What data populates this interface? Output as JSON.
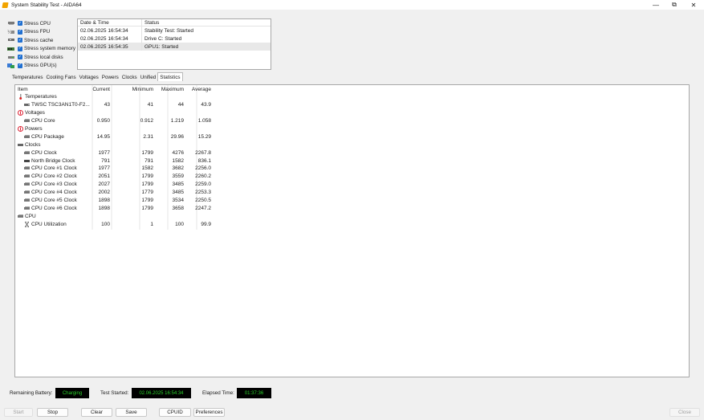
{
  "window": {
    "title": "System Stability Test - AIDA64",
    "minimize_glyph": "—",
    "maximize_glyph": "⧉",
    "close_glyph": "✕"
  },
  "stress_options": [
    {
      "label": "Stress CPU",
      "icon": "cpu-icon",
      "checked": true
    },
    {
      "label": "Stress FPU",
      "icon": "fpu-icon",
      "checked": true
    },
    {
      "label": "Stress cache",
      "icon": "cache-icon",
      "checked": true
    },
    {
      "label": "Stress system memory",
      "icon": "memory-icon",
      "checked": true
    },
    {
      "label": "Stress local disks",
      "icon": "disk-icon",
      "checked": true
    },
    {
      "label": "Stress GPU(s)",
      "icon": "gpu-icon",
      "checked": true
    }
  ],
  "log": {
    "headers": [
      "Date & Time",
      "Status"
    ],
    "rows": [
      {
        "time": "02.06.2025 16:54:34",
        "status": "Stability Test: Started"
      },
      {
        "time": "02.06.2025 16:54:34",
        "status": "Drive C: Started"
      },
      {
        "time": "02.06.2025 16:54:35",
        "status": "GPU1: Started"
      }
    ]
  },
  "tabs": [
    "Temperatures",
    "Cooling Fans",
    "Voltages",
    "Powers",
    "Clocks",
    "Unified",
    "Statistics"
  ],
  "active_tab": "Statistics",
  "stats": {
    "headers": {
      "item": "Item",
      "current": "Current",
      "minimum": "Minimum",
      "maximum": "Maximum",
      "average": "Average"
    },
    "rows": [
      {
        "level": 1,
        "icon": "thermometer-icon",
        "label": "Temperatures",
        "cur": "",
        "min": "",
        "max": "",
        "avg": ""
      },
      {
        "level": 2,
        "icon": "drive-icon",
        "label": "TWSC TSC3AN1T0-F2...",
        "cur": "43",
        "min": "41",
        "max": "44",
        "avg": "43.9"
      },
      {
        "level": 1,
        "icon": "voltage-icon",
        "label": "Voltages",
        "cur": "",
        "min": "",
        "max": "",
        "avg": ""
      },
      {
        "level": 2,
        "icon": "chip-icon",
        "label": "CPU Core",
        "cur": "0.950",
        "min": "0.912",
        "max": "1.219",
        "avg": "1.058"
      },
      {
        "level": 1,
        "icon": "power-icon",
        "label": "Powers",
        "cur": "",
        "min": "",
        "max": "",
        "avg": ""
      },
      {
        "level": 2,
        "icon": "chip-icon",
        "label": "CPU Package",
        "cur": "14.95",
        "min": "2.31",
        "max": "29.96",
        "avg": "15.29"
      },
      {
        "level": 1,
        "icon": "clock-icon",
        "label": "Clocks",
        "cur": "",
        "min": "",
        "max": "",
        "avg": ""
      },
      {
        "level": 2,
        "icon": "chip-icon",
        "label": "CPU Clock",
        "cur": "1977",
        "min": "1799",
        "max": "4276",
        "avg": "2267.8"
      },
      {
        "level": 2,
        "icon": "northbridge-icon",
        "label": "North Bridge Clock",
        "cur": "791",
        "min": "791",
        "max": "1582",
        "avg": "836.1"
      },
      {
        "level": 2,
        "icon": "chip-icon",
        "label": "CPU Core #1 Clock",
        "cur": "1977",
        "min": "1582",
        "max": "3682",
        "avg": "2256.0"
      },
      {
        "level": 2,
        "icon": "chip-icon",
        "label": "CPU Core #2 Clock",
        "cur": "2051",
        "min": "1799",
        "max": "3559",
        "avg": "2260.2"
      },
      {
        "level": 2,
        "icon": "chip-icon",
        "label": "CPU Core #3 Clock",
        "cur": "2027",
        "min": "1799",
        "max": "3485",
        "avg": "2259.0"
      },
      {
        "level": 2,
        "icon": "chip-icon",
        "label": "CPU Core #4 Clock",
        "cur": "2002",
        "min": "1779",
        "max": "3485",
        "avg": "2253.3"
      },
      {
        "level": 2,
        "icon": "chip-icon",
        "label": "CPU Core #5 Clock",
        "cur": "1898",
        "min": "1799",
        "max": "3534",
        "avg": "2250.5"
      },
      {
        "level": 2,
        "icon": "chip-icon",
        "label": "CPU Core #6 Clock",
        "cur": "1898",
        "min": "1799",
        "max": "3658",
        "avg": "2247.2"
      },
      {
        "level": 1,
        "icon": "cpu-group-icon",
        "label": "CPU",
        "cur": "",
        "min": "",
        "max": "",
        "avg": ""
      },
      {
        "level": 2,
        "icon": "hourglass-icon",
        "label": "CPU Utilization",
        "cur": "100",
        "min": "1",
        "max": "100",
        "avg": "99.9"
      }
    ]
  },
  "status": {
    "battery_label": "Remaining Battery:",
    "battery_value": "Charging",
    "started_label": "Test Started:",
    "started_value": "02.06.2025 16:54:34",
    "elapsed_label": "Elapsed Time:",
    "elapsed_value": "01:37:36"
  },
  "buttons": {
    "start": "Start",
    "stop": "Stop",
    "clear": "Clear",
    "save": "Save",
    "cpuid": "CPUID",
    "preferences": "Preferences",
    "close": "Close"
  },
  "colors": {
    "checkbox": "#1f6fd1",
    "status_text": "#2bd12b",
    "status_bg": "#000000",
    "accent_icon": "#f2a400"
  }
}
